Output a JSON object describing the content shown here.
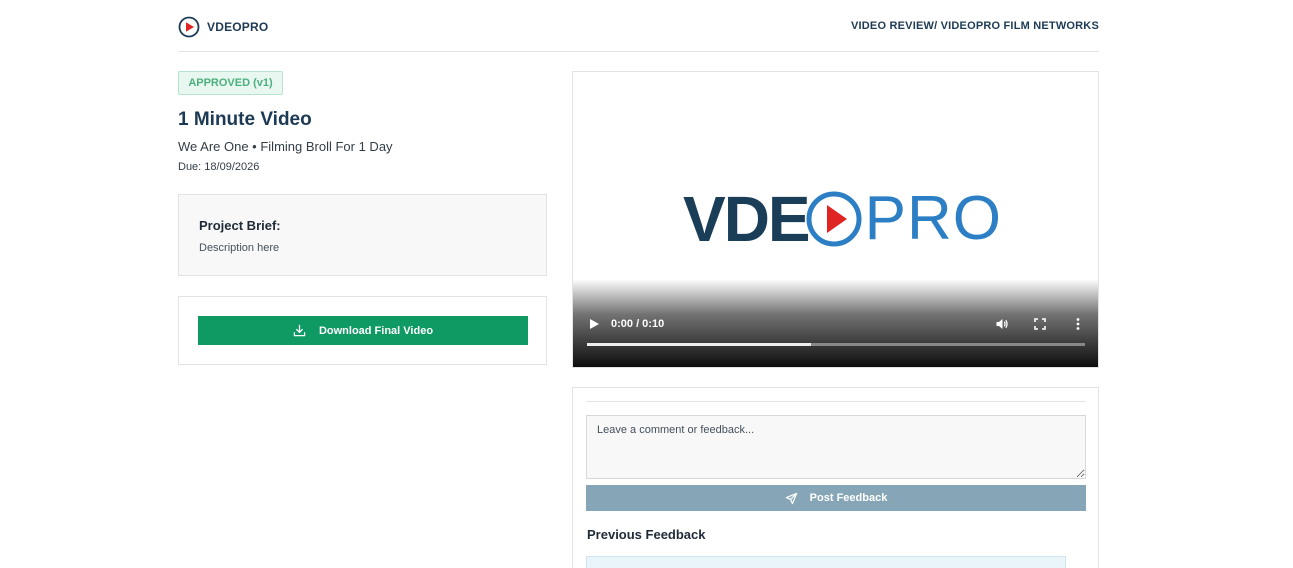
{
  "header": {
    "brand_name": "VDEOPRO",
    "breadcrumb": "VIDEO REVIEW/ VIDEOPRO FILM NETWORKS"
  },
  "project": {
    "status_badge": "APPROVED (v1)",
    "title": "1 Minute Video",
    "subtitle": "We Are One • Filming Broll For 1 Day",
    "due": "Due: 18/09/2026"
  },
  "brief": {
    "title": "Project Brief:",
    "description": "Description here"
  },
  "download": {
    "label": "Download Final Video"
  },
  "video": {
    "logo_text_left": "VDE",
    "logo_text_right": "PRO",
    "time": "0:00 / 0:10",
    "progress_fraction": 0.45
  },
  "comments": {
    "placeholder": "Leave a comment or feedback...",
    "post_label": "Post Feedback",
    "previous_title": "Previous Feedback"
  },
  "icons": {
    "brand": "play-circle-icon",
    "download": "download-icon",
    "play": "play-icon",
    "volume": "volume-icon",
    "fullscreen": "fullscreen-icon",
    "more": "more-vertical-icon",
    "send": "send-icon"
  },
  "colors": {
    "brand_navy": "#1d3a55",
    "brand_red": "#e02424",
    "brand_blue": "#2c7fc4",
    "approved_green": "#4caf7e",
    "download_green": "#0f9a63",
    "post_button": "#86a6b8"
  }
}
